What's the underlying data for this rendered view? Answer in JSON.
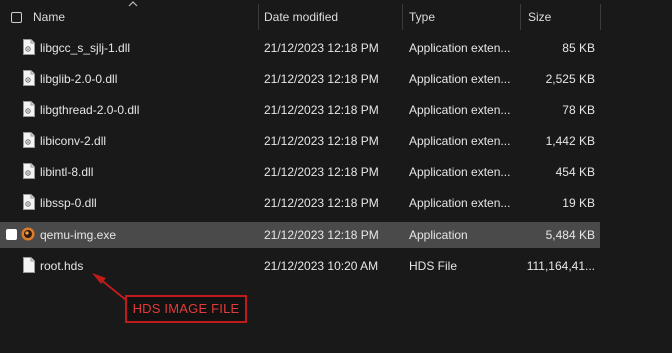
{
  "columns": {
    "name": "Name",
    "date": "Date modified",
    "type": "Type",
    "size": "Size"
  },
  "files": [
    {
      "name": "libgcc_s_sjlj-1.dll",
      "date": "21/12/2023 12:18 PM",
      "type": "Application exten...",
      "size": "85 KB",
      "icon": "dll-file-icon"
    },
    {
      "name": "libglib-2.0-0.dll",
      "date": "21/12/2023 12:18 PM",
      "type": "Application exten...",
      "size": "2,525 KB",
      "icon": "dll-file-icon"
    },
    {
      "name": "libgthread-2.0-0.dll",
      "date": "21/12/2023 12:18 PM",
      "type": "Application exten...",
      "size": "78 KB",
      "icon": "dll-file-icon"
    },
    {
      "name": "libiconv-2.dll",
      "date": "21/12/2023 12:18 PM",
      "type": "Application exten...",
      "size": "1,442 KB",
      "icon": "dll-file-icon"
    },
    {
      "name": "libintl-8.dll",
      "date": "21/12/2023 12:18 PM",
      "type": "Application exten...",
      "size": "454 KB",
      "icon": "dll-file-icon"
    },
    {
      "name": "libssp-0.dll",
      "date": "21/12/2023 12:18 PM",
      "type": "Application exten...",
      "size": "19 KB",
      "icon": "dll-file-icon"
    },
    {
      "name": "qemu-img.exe",
      "date": "21/12/2023 12:18 PM",
      "type": "Application",
      "size": "5,484 KB",
      "icon": "qemu-app-icon",
      "selected": true
    },
    {
      "name": "root.hds",
      "date": "21/12/2023 10:20 AM",
      "type": "HDS File",
      "size": "111,164,41...",
      "icon": "generic-file-icon"
    }
  ],
  "annotation": {
    "label": "HDS IMAGE FILE",
    "color": "#c01b1b"
  },
  "colors": {
    "background": "#191919",
    "selected_row": "#4a4a4a",
    "text": "#e6e6e6"
  }
}
